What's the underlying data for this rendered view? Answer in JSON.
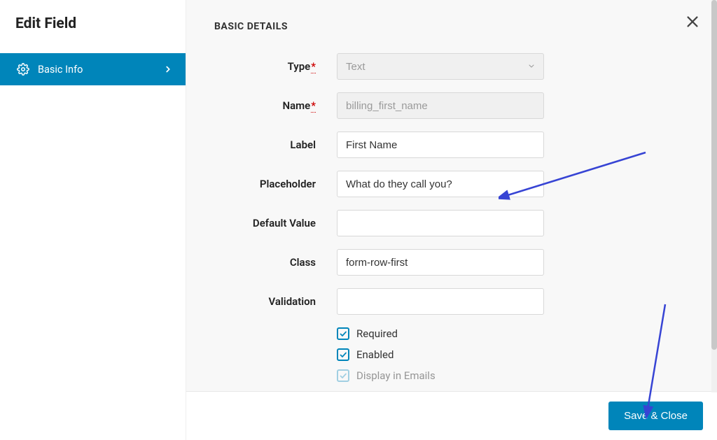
{
  "sidebar": {
    "title": "Edit Field",
    "item_label": "Basic Info"
  },
  "main": {
    "section_title": "BASIC DETAILS",
    "labels": {
      "type": "Type",
      "name": "Name",
      "label": "Label",
      "placeholder": "Placeholder",
      "default_value": "Default Value",
      "class": "Class",
      "validation": "Validation"
    },
    "values": {
      "type": "Text",
      "name": "billing_first_name",
      "label": "First Name",
      "placeholder": "What do they call you?",
      "default_value": "",
      "class": "form-row-first",
      "validation": ""
    },
    "checkboxes": {
      "required": {
        "label": "Required",
        "checked": true
      },
      "enabled": {
        "label": "Enabled",
        "checked": true
      },
      "display_emails": {
        "label": "Display in Emails",
        "checked": true
      }
    },
    "required_marker": "*"
  },
  "footer": {
    "save_label": "Save & Close"
  }
}
